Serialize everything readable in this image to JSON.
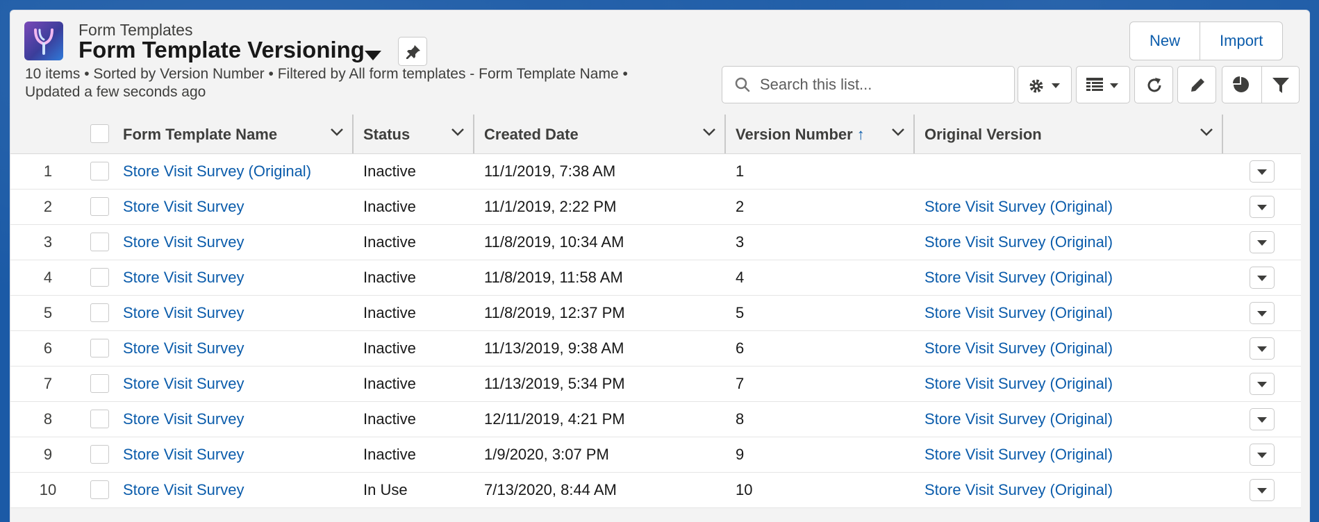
{
  "header": {
    "object_name": "Form Templates",
    "list_view_name": "Form Template Versioning",
    "meta_line1": "10 items • Sorted by Version Number • Filtered by All form templates - Form Template Name •",
    "meta_line2": "Updated a few seconds ago",
    "buttons": {
      "new": "New",
      "import": "Import"
    },
    "search": {
      "placeholder": "Search this list..."
    }
  },
  "icons": {
    "app": "app-logo-icon",
    "pin": "pin-icon",
    "search": "search-icon",
    "settings": "gear-icon",
    "display": "table-display-icon",
    "refresh": "refresh-icon",
    "edit": "pencil-icon",
    "chart": "pie-chart-icon",
    "filter": "filter-icon"
  },
  "colors": {
    "link": "#0b5cab",
    "brand_bg": "#1b5aa6"
  },
  "table": {
    "columns": {
      "name": "Form Template Name",
      "status": "Status",
      "created": "Created Date",
      "version": "Version Number",
      "original": "Original Version"
    },
    "sort": {
      "column": "Version Number",
      "direction": "ascending"
    },
    "rows": [
      {
        "num": "1",
        "name": "Store Visit Survey (Original)",
        "status": "Inactive",
        "created": "11/1/2019, 7:38 AM",
        "version": "1",
        "original": ""
      },
      {
        "num": "2",
        "name": "Store Visit Survey",
        "status": "Inactive",
        "created": "11/1/2019, 2:22 PM",
        "version": "2",
        "original": "Store Visit Survey (Original)"
      },
      {
        "num": "3",
        "name": "Store Visit Survey",
        "status": "Inactive",
        "created": "11/8/2019, 10:34 AM",
        "version": "3",
        "original": "Store Visit Survey (Original)"
      },
      {
        "num": "4",
        "name": "Store Visit Survey",
        "status": "Inactive",
        "created": "11/8/2019, 11:58 AM",
        "version": "4",
        "original": "Store Visit Survey (Original)"
      },
      {
        "num": "5",
        "name": "Store Visit Survey",
        "status": "Inactive",
        "created": "11/8/2019, 12:37 PM",
        "version": "5",
        "original": "Store Visit Survey (Original)"
      },
      {
        "num": "6",
        "name": "Store Visit Survey",
        "status": "Inactive",
        "created": "11/13/2019, 9:38 AM",
        "version": "6",
        "original": "Store Visit Survey (Original)"
      },
      {
        "num": "7",
        "name": "Store Visit Survey",
        "status": "Inactive",
        "created": "11/13/2019, 5:34 PM",
        "version": "7",
        "original": "Store Visit Survey (Original)"
      },
      {
        "num": "8",
        "name": "Store Visit Survey",
        "status": "Inactive",
        "created": "12/11/2019, 4:21 PM",
        "version": "8",
        "original": "Store Visit Survey (Original)"
      },
      {
        "num": "9",
        "name": "Store Visit Survey",
        "status": "Inactive",
        "created": "1/9/2020, 3:07 PM",
        "version": "9",
        "original": "Store Visit Survey (Original)"
      },
      {
        "num": "10",
        "name": "Store Visit Survey",
        "status": "In Use",
        "created": "7/13/2020, 8:44 AM",
        "version": "10",
        "original": "Store Visit Survey (Original)"
      }
    ]
  }
}
